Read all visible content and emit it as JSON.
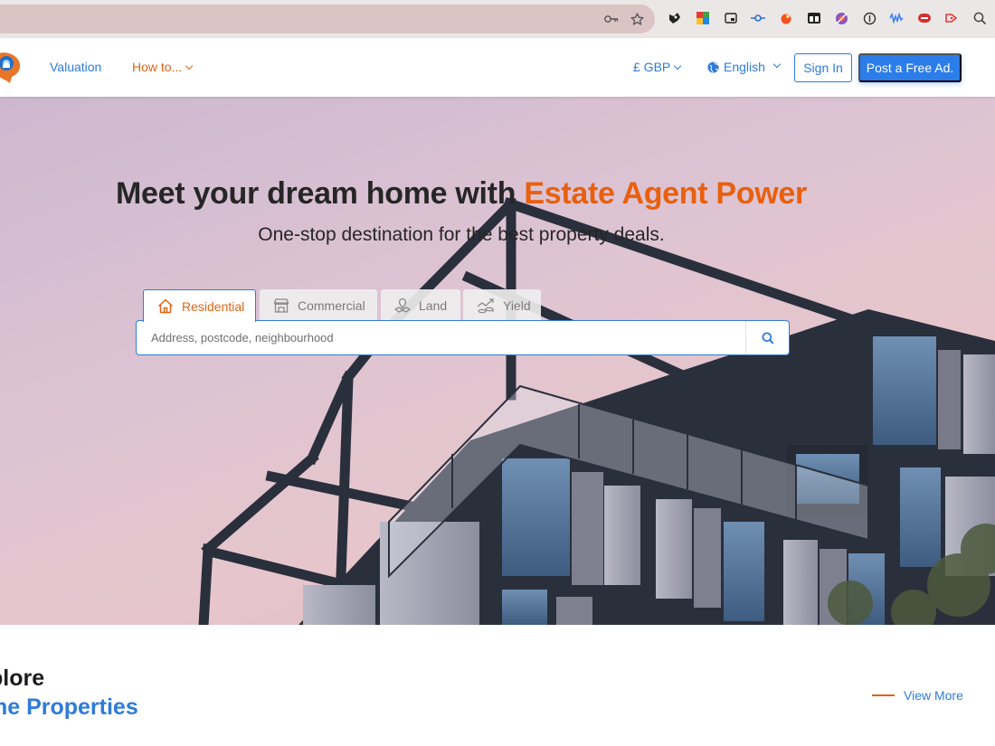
{
  "browser": {
    "toolbar_icons": [
      "password-key-icon",
      "bookmark-star-icon"
    ],
    "extension_icons": [
      "ext-puzzle-icon",
      "ext-colorgrid-icon",
      "ext-pip-icon",
      "ext-commit-icon",
      "ext-fire-icon",
      "ext-tabs-icon",
      "ext-blocked-icon",
      "ext-circle-icon",
      "ext-wave-icon",
      "ext-lastpass-icon",
      "ext-arrow-icon",
      "search-icon"
    ]
  },
  "header": {
    "nav": {
      "valuation": "Valuation",
      "howto": "How to..."
    },
    "currency": "£ GBP",
    "language": "English",
    "sign_in": "Sign In",
    "post_ad": "Post a Free Ad."
  },
  "hero": {
    "title_prefix": "Meet your dream home with ",
    "title_accent": "Estate Agent Power",
    "subtitle": "One-stop destination for the best property deals.",
    "tabs": [
      {
        "label": "Residential",
        "icon": "house-icon",
        "active": true
      },
      {
        "label": "Commercial",
        "icon": "shop-icon",
        "active": false
      },
      {
        "label": "Land",
        "icon": "land-pin-icon",
        "active": false
      },
      {
        "label": "Yield",
        "icon": "yield-chart-icon",
        "active": false
      }
    ],
    "search_placeholder": "Address, postcode, neighbourhood"
  },
  "explore": {
    "line1": "plore",
    "line2": "me Properties",
    "view_more": "View More"
  },
  "colors": {
    "brand_blue": "#2e7bd9",
    "brand_orange": "#e8600e",
    "button_blue": "#2b7de9"
  }
}
